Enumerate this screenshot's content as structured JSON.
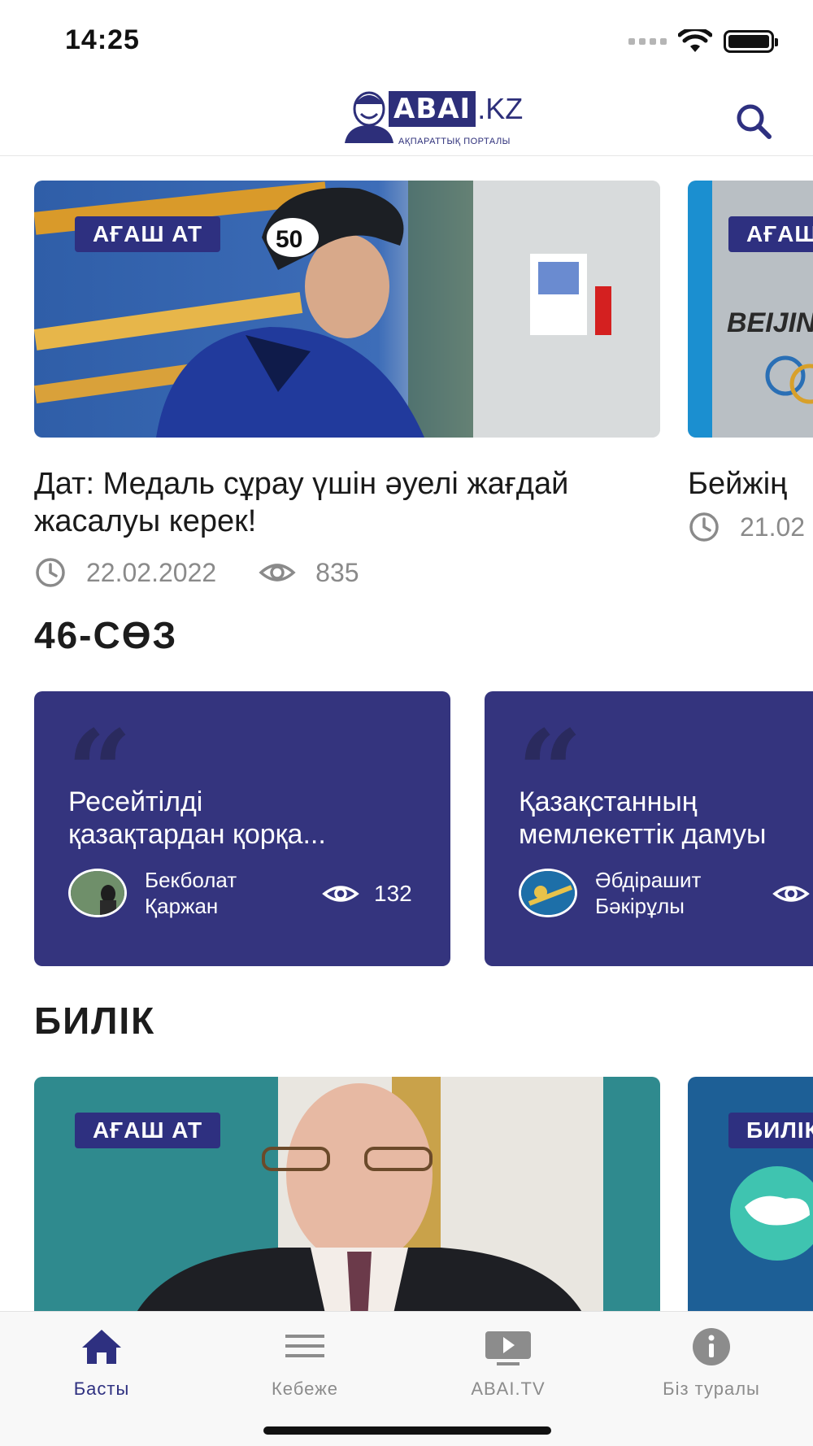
{
  "status_bar": {
    "time": "14:25"
  },
  "header": {
    "logo_main": "ABAI",
    "logo_suffix": ".KZ",
    "logo_subtitle": "АҚПАРАТТЫҚ ПОРТАЛЫ"
  },
  "featured": [
    {
      "badge": "АҒАШ АТ",
      "title": "Дат: Медаль сұрау үшін әуелі жағдай жасалуы керек!",
      "date": "22.02.2022",
      "views": "835"
    },
    {
      "badge": "АҒАШ АТ",
      "title": "Бейжің",
      "date": "21.02"
    }
  ],
  "section_quotes": {
    "title": "46-СӨЗ"
  },
  "quotes": [
    {
      "text": "Ресейтілді\nқазақтардан қорқа...",
      "author": "Бекболат\nҚаржан",
      "views": "132"
    },
    {
      "text": "Қазақстанның\nмемлекеттік дамуы",
      "author": "Әбдірашит\nБәкірұлы",
      "views": ""
    }
  ],
  "section_bilik": {
    "title": "БИЛІК"
  },
  "bilik": [
    {
      "badge": "АҒАШ АТ"
    },
    {
      "badge": "БИЛІК"
    }
  ],
  "tabs": [
    {
      "label": "Басты",
      "icon": "home-icon",
      "active": true
    },
    {
      "label": "Кебеже",
      "icon": "menu-icon",
      "active": false
    },
    {
      "label": "ABAI.TV",
      "icon": "play-icon",
      "active": false
    },
    {
      "label": "Біз туралы",
      "icon": "info-icon",
      "active": false
    }
  ],
  "colors": {
    "brand": "#2e3080",
    "quote_card": "#34347e",
    "muted": "#8c8c8c"
  }
}
